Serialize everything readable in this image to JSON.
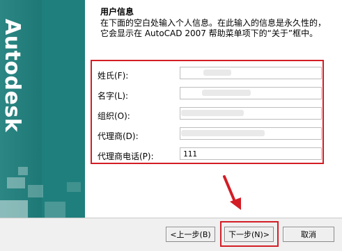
{
  "brand": {
    "name": "Autodesk"
  },
  "section": {
    "title": "用户信息",
    "description": "在下面的空白处输入个人信息。在此输入的信息是永久性的，它会显示在 AutoCAD 2007 帮助菜单项下的“关于”框中。"
  },
  "fields": [
    {
      "label": "姓氏(F):",
      "value": ""
    },
    {
      "label": "名字(L):",
      "value": ""
    },
    {
      "label": "组织(O):",
      "value": ""
    },
    {
      "label": "代理商(D):",
      "value": ""
    },
    {
      "label": "代理商电话(P):",
      "value": "111"
    }
  ],
  "buttons": {
    "back": "<上一步(B)",
    "next": "下一步(N)>",
    "cancel": "取消"
  },
  "colors": {
    "banner": "#1f7f7c",
    "highlight": "#d31d25"
  }
}
